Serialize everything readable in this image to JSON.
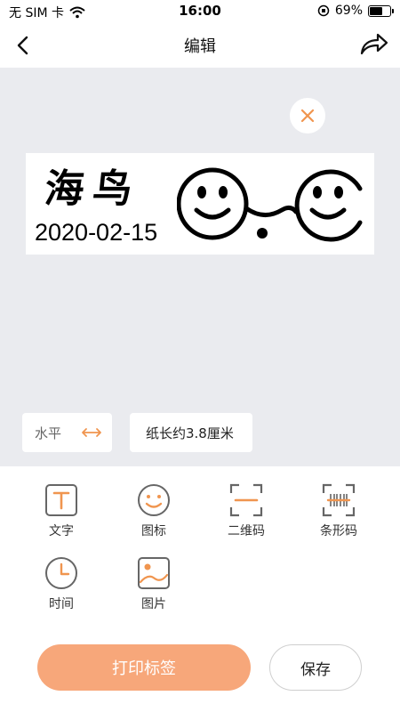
{
  "status_bar": {
    "carrier": "无 SIM 卡",
    "time": "16:00",
    "battery": "69%",
    "battery_level": 0.69
  },
  "nav": {
    "title": "编辑"
  },
  "label": {
    "title_text": "海鸟",
    "date_text": "2020-02-15"
  },
  "controls": {
    "orientation_label": "水平",
    "paper_length": "纸长约3.8厘米"
  },
  "tools": [
    {
      "label": "文字",
      "icon": "text-icon"
    },
    {
      "label": "图标",
      "icon": "smiley-icon"
    },
    {
      "label": "二维码",
      "icon": "qrcode-icon"
    },
    {
      "label": "条形码",
      "icon": "barcode-icon"
    },
    {
      "label": "时间",
      "icon": "clock-icon"
    },
    {
      "label": "图片",
      "icon": "image-icon"
    }
  ],
  "actions": {
    "print_label": "打印标签",
    "save_label": "保存"
  },
  "colors": {
    "accent": "#f7a77a",
    "icon_orange": "#f0954f",
    "canvas_bg": "#eaebef"
  }
}
